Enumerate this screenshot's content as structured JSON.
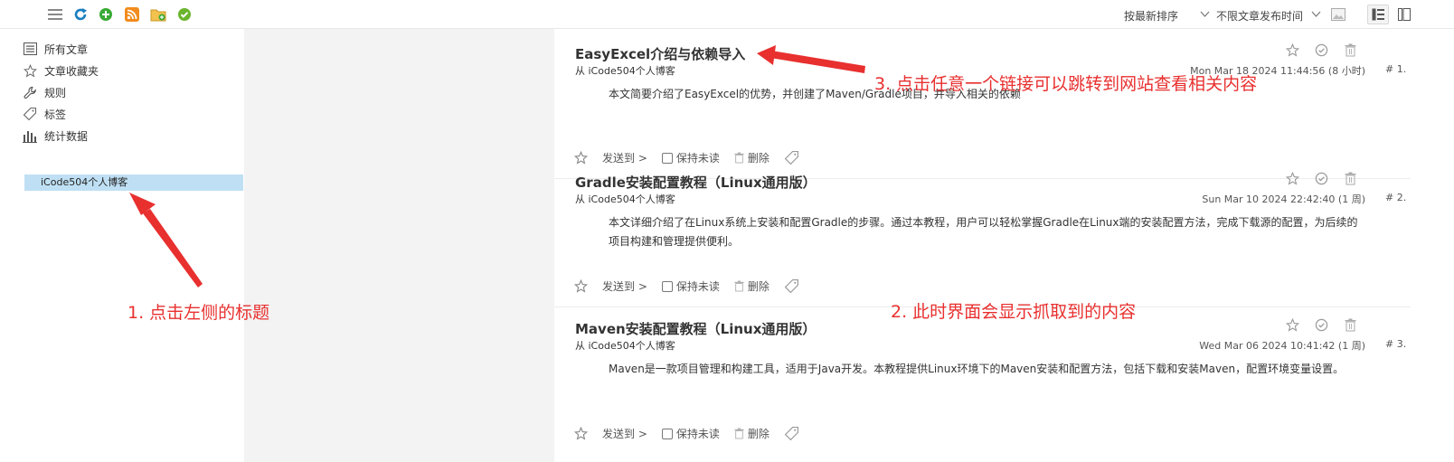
{
  "toolbar": {
    "sort_label": "按最新排序",
    "time_filter_label": "不限文章发布时间"
  },
  "sidebar": {
    "items": [
      {
        "label": "所有文章",
        "icon": "all-articles-icon"
      },
      {
        "label": "文章收藏夹",
        "icon": "star-icon"
      },
      {
        "label": "规则",
        "icon": "wrench-icon"
      },
      {
        "label": "标签",
        "icon": "tag-icon"
      },
      {
        "label": "统计数据",
        "icon": "bar-chart-icon"
      }
    ],
    "feed": "iCode504个人博客"
  },
  "articles": [
    {
      "title": "EasyExcel介绍与依赖导入",
      "source": "从 iCode504个人博客",
      "date": "Mon Mar 18 2024 11:44:56 (8 小时)",
      "num": "# 1.",
      "summary": "本文简要介绍了EasyExcel的优势，并创建了Maven/Gradle项目，并导入相关的依赖"
    },
    {
      "title": "Gradle安装配置教程（Linux通用版）",
      "source": "从 iCode504个人博客",
      "date": "Sun Mar 10 2024 22:42:40 (1 周)",
      "num": "# 2.",
      "summary": "本文详细介绍了在Linux系统上安装和配置Gradle的步骤。通过本教程，用户可以轻松掌握Gradle在Linux端的安装配置方法，完成下载源的配置，为后续的项目构建和管理提供便利。"
    },
    {
      "title": "Maven安装配置教程（Linux通用版）",
      "source": "从 iCode504个人博客",
      "date": "Wed Mar 06 2024 10:41:42 (1 周)",
      "num": "# 3.",
      "summary": "Maven是一款项目管理和构建工具，适用于Java开发。本教程提供Linux环境下的Maven安装和配置方法，包括下载和安装Maven，配置环境变量设置。"
    }
  ],
  "actions": {
    "send_to": "发送到 >",
    "keep_unread": "保持未读",
    "delete": "删除"
  },
  "annotations": {
    "step1": "1. 点击左侧的标题",
    "step2": "2. 此时界面会显示抓取到的内容",
    "step3": "3. 点击任意一个链接可以跳转到网站查看相关内容"
  },
  "colors": {
    "annotation": "#e8302f",
    "selected_feed_bg": "#bfe0f4",
    "gap_bg": "#f3f3f3"
  }
}
